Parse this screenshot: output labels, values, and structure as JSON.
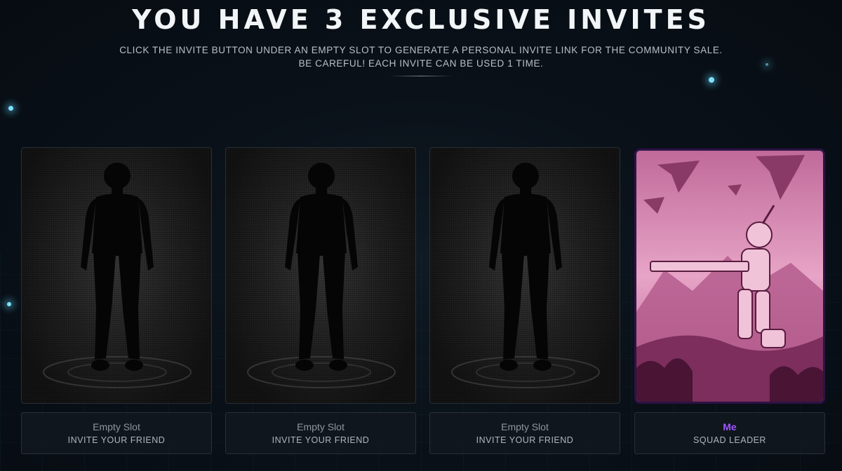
{
  "header": {
    "title": "YOU HAVE 3 EXCLUSIVE INVITES",
    "line1": "CLICK THE INVITE BUTTON UNDER AN EMPTY SLOT TO GENERATE A PERSONAL INVITE LINK FOR THE COMMUNITY SALE.",
    "line2": "BE CAREFUL! EACH INVITE CAN BE USED 1 TIME."
  },
  "slots": [
    {
      "name": "Empty Slot",
      "role": "INVITE YOUR FRIEND"
    },
    {
      "name": "Empty Slot",
      "role": "INVITE YOUR FRIEND"
    },
    {
      "name": "Empty Slot",
      "role": "INVITE YOUR FRIEND"
    },
    {
      "name": "Me",
      "role": "SQUAD LEADER"
    }
  ],
  "colors": {
    "accent": "#9d55ff",
    "leader_art": "#d07aa8"
  }
}
